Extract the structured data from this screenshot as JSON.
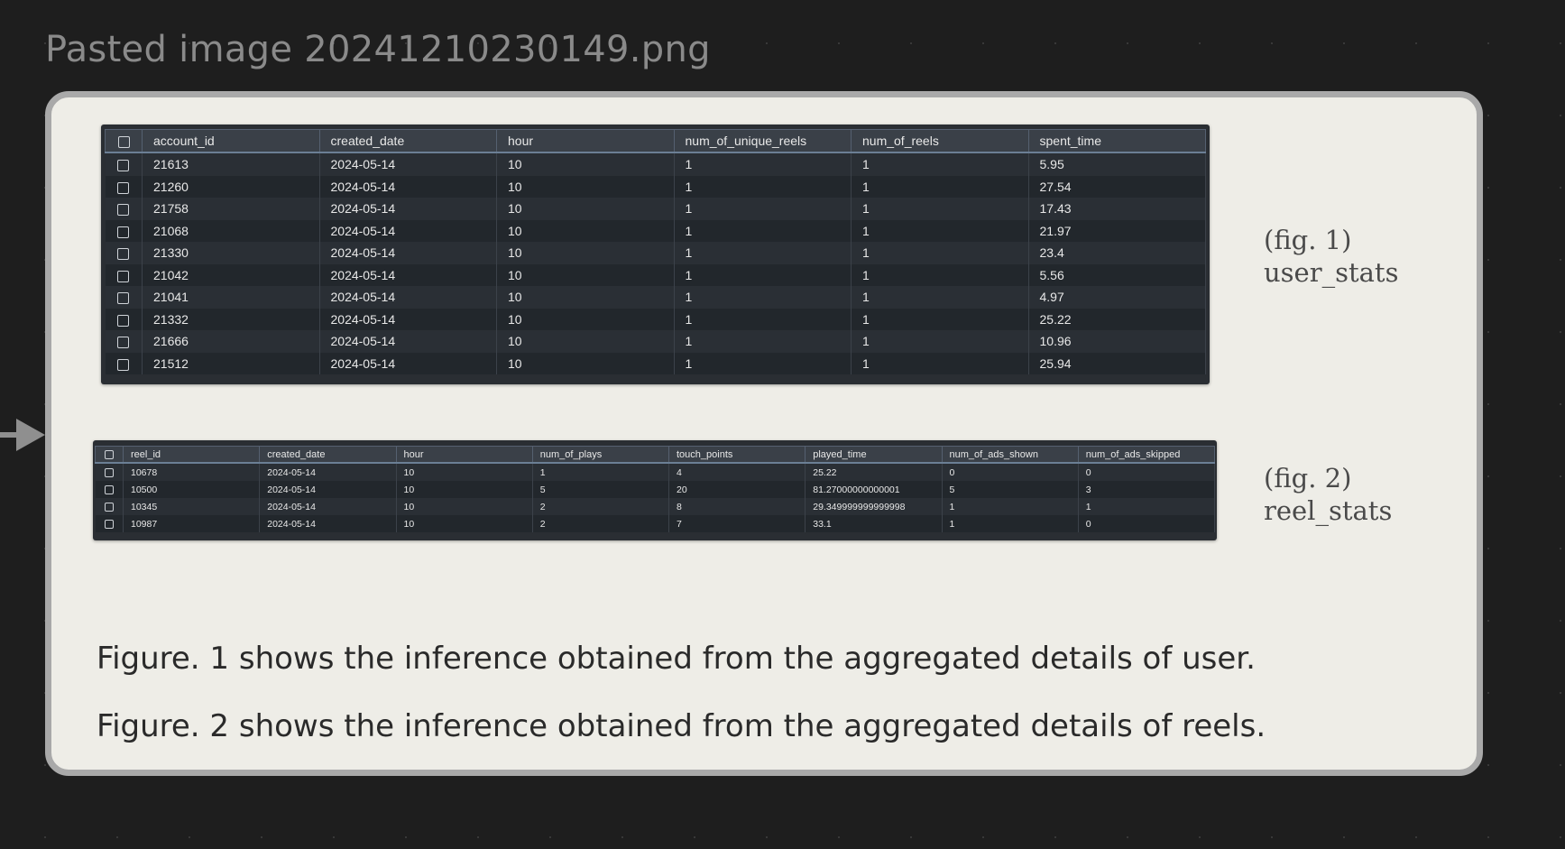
{
  "canvas": {
    "title": "Pasted image 20241210230149.png"
  },
  "user_stats": {
    "columns": [
      "account_id",
      "created_date",
      "hour",
      "num_of_unique_reels",
      "num_of_reels",
      "spent_time"
    ],
    "rows": [
      [
        "21613",
        "2024-05-14",
        "10",
        "1",
        "1",
        "5.95"
      ],
      [
        "21260",
        "2024-05-14",
        "10",
        "1",
        "1",
        "27.54"
      ],
      [
        "21758",
        "2024-05-14",
        "10",
        "1",
        "1",
        "17.43"
      ],
      [
        "21068",
        "2024-05-14",
        "10",
        "1",
        "1",
        "21.97"
      ],
      [
        "21330",
        "2024-05-14",
        "10",
        "1",
        "1",
        "23.4"
      ],
      [
        "21042",
        "2024-05-14",
        "10",
        "1",
        "1",
        "5.56"
      ],
      [
        "21041",
        "2024-05-14",
        "10",
        "1",
        "1",
        "4.97"
      ],
      [
        "21332",
        "2024-05-14",
        "10",
        "1",
        "1",
        "25.22"
      ],
      [
        "21666",
        "2024-05-14",
        "10",
        "1",
        "1",
        "10.96"
      ],
      [
        "21512",
        "2024-05-14",
        "10",
        "1",
        "1",
        "25.94"
      ]
    ],
    "fig_label": "(fig. 1)",
    "name_label": "user_stats"
  },
  "reel_stats": {
    "columns": [
      "reel_id",
      "created_date",
      "hour",
      "num_of_plays",
      "touch_points",
      "played_time",
      "num_of_ads_shown",
      "num_of_ads_skipped"
    ],
    "rows": [
      [
        "10678",
        "2024-05-14",
        "10",
        "1",
        "4",
        "25.22",
        "0",
        "0"
      ],
      [
        "10500",
        "2024-05-14",
        "10",
        "5",
        "20",
        "81.27000000000001",
        "5",
        "3"
      ],
      [
        "10345",
        "2024-05-14",
        "10",
        "2",
        "8",
        "29.349999999999998",
        "1",
        "1"
      ],
      [
        "10987",
        "2024-05-14",
        "10",
        "2",
        "7",
        "33.1",
        "1",
        "0"
      ]
    ],
    "fig_label": "(fig. 2)",
    "name_label": "reel_stats"
  },
  "captions": {
    "line1": "Figure. 1  shows the inference obtained from the aggregated details of user.",
    "line2": "Figure. 2  shows the inference obtained from the aggregated details of reels."
  }
}
